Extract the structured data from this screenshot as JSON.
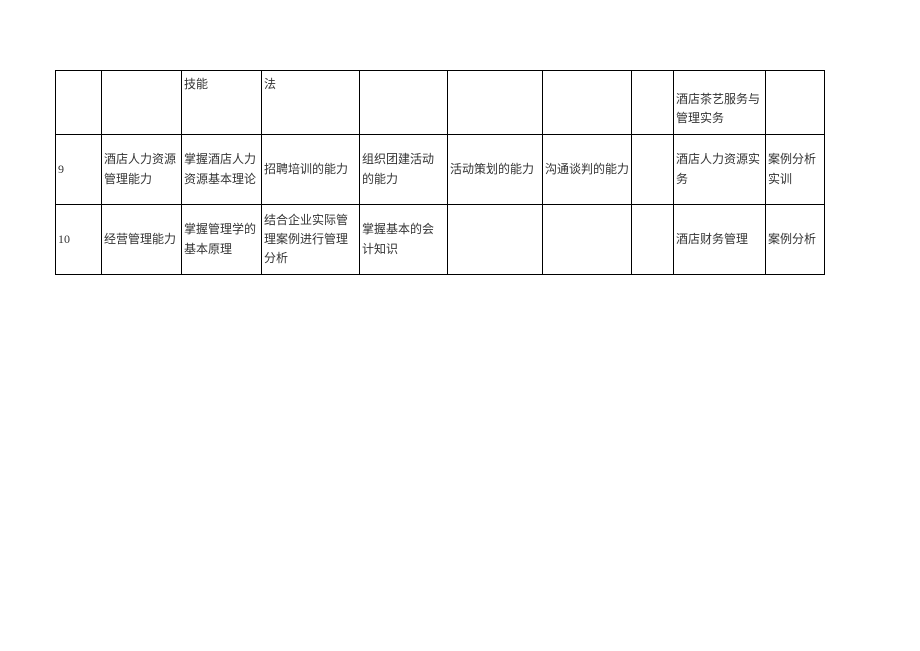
{
  "table": {
    "rows": [
      {
        "idx": "",
        "c1": "",
        "c2": "技能",
        "c3": "法",
        "c4": "",
        "c5": "",
        "c6": "",
        "c7": "",
        "c8": "酒店茶艺服务与管理实务",
        "c9": ""
      },
      {
        "idx": "9",
        "c1": "酒店人力资源管理能力",
        "c2": "掌握酒店人力资源基本理论",
        "c3": "招聘培训的能力",
        "c4": "组织团建活动的能力",
        "c5": "活动策划的能力",
        "c6": "沟通谈判的能力",
        "c7": "",
        "c8": "酒店人力资源实务",
        "c9": "案例分析实训"
      },
      {
        "idx": "10",
        "c1": "经营管理能力",
        "c2": "掌握管理学的基本原理",
        "c3": "结合企业实际管理案例进行管理分析",
        "c4": "掌握基本的会计知识",
        "c5": "",
        "c6": "",
        "c7": "",
        "c8": "酒店财务管理",
        "c9": "案例分析"
      }
    ]
  }
}
